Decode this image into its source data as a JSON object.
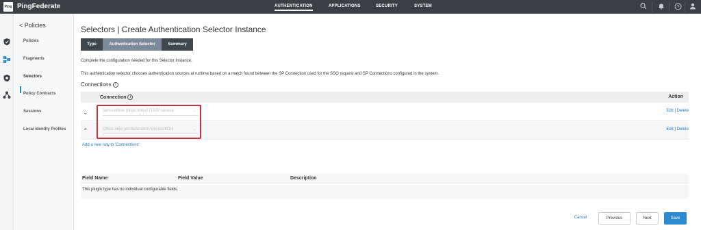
{
  "topbar": {
    "logo": "Ping",
    "brand": "PingFederate",
    "nav": [
      "AUTHENTICATION",
      "APPLICATIONS",
      "SECURITY",
      "SYSTEM"
    ],
    "icons": [
      "search-icon",
      "bell-icon",
      "help-icon",
      "user-icon"
    ]
  },
  "sidenav": {
    "back_label": "< Policies",
    "items": [
      "Policies",
      "Fragments",
      "Selectors",
      "Policy Contracts",
      "Sessions",
      "Local Identity Profiles"
    ],
    "active": "Selectors"
  },
  "main": {
    "title": "Selectors | Create Authentication Selector Instance",
    "steps": [
      "Type",
      "Authentication Selector",
      "Summary"
    ],
    "desc1": "Complete the configuration needed for this Selector Instance.",
    "desc2": "This authentication selector chooses authentication sources at runtime based on a match found between the SP Connection used for the SSO request and SP Connections configured in the system.",
    "connections_label": "Connections",
    "info_icon": "i",
    "table": {
      "col_connection": "Connection",
      "col_action": "Action",
      "rows": [
        {
          "chevron": "⌄",
          "value": "ServiceNow (https://dev271537.service",
          "edit": "Edit",
          "delete": "Delete"
        },
        {
          "chevron": "⌃",
          "value": "Office 365 (urn:federation:MicrosoftOnl",
          "edit": "Edit",
          "delete": "Delete"
        }
      ]
    },
    "add_row_link": "Add a new row to 'Connections'",
    "fields": {
      "col_name": "Field Name",
      "col_value": "Field Value",
      "col_desc": "Description",
      "message": "This plugin type has no individual configurable fields."
    }
  },
  "buttons": {
    "cancel": "Cancel",
    "previous": "Previous",
    "next": "Next",
    "save": "Save"
  },
  "colors": {
    "topbar": "#3a3f45",
    "accent": "#2d8ad1",
    "highlight": "#c8313a"
  }
}
